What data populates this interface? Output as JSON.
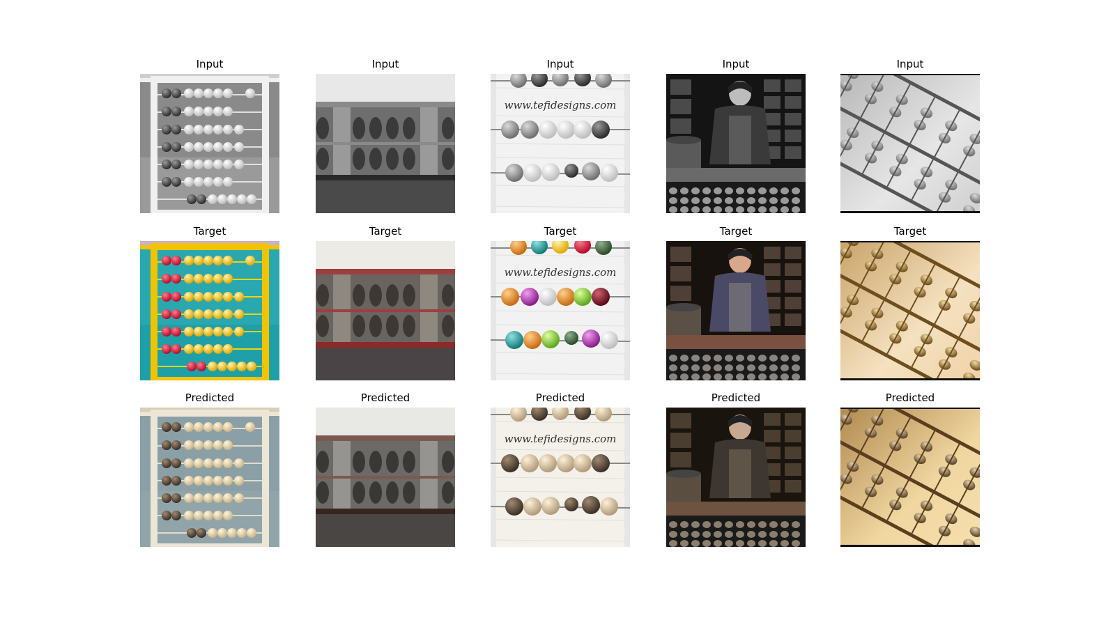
{
  "rows": [
    {
      "title": "Input"
    },
    {
      "title": "Target"
    },
    {
      "title": "Predicted"
    }
  ],
  "watermark": "www.tefidesigns.com"
}
